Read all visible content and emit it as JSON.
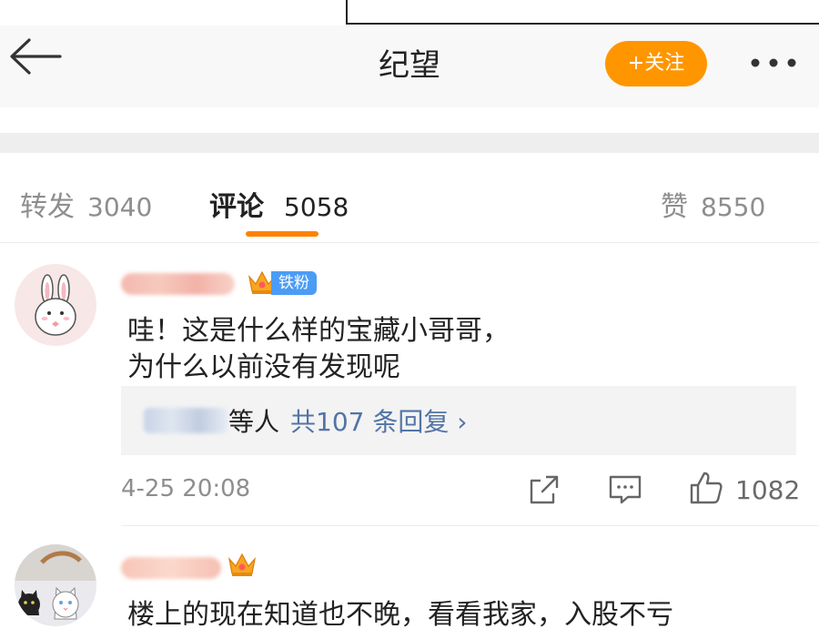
{
  "header": {
    "title": "纪望",
    "follow_label": "+关注"
  },
  "tabs": {
    "repost": {
      "label": "转发",
      "count": "3040"
    },
    "comment": {
      "label": "评论",
      "count": "5058"
    },
    "like": {
      "label": "赞",
      "count": "8550"
    }
  },
  "comments": [
    {
      "badge": "铁粉",
      "crown_level": "6",
      "text_line1": "哇！这是什么样的宝藏小哥哥，",
      "text_line2": "为什么以前没有发现呢",
      "reply_summary": {
        "suffix": "等人",
        "count_link": "共107",
        "link_tail": "条回复 ›"
      },
      "timestamp": "4-25 20:08",
      "likes": "1082"
    },
    {
      "crown_level": "4",
      "text": "楼上的现在知道也不晚，看看我家，入股不亏"
    }
  ],
  "colors": {
    "accent": "#ff8200",
    "follow_button": "#ff9600",
    "link": "#5274a6",
    "badge": "#4b9cf5"
  },
  "icons": [
    "back-arrow-icon",
    "more-dots-icon",
    "crown-icon",
    "share-icon",
    "comment-icon",
    "like-icon"
  ]
}
